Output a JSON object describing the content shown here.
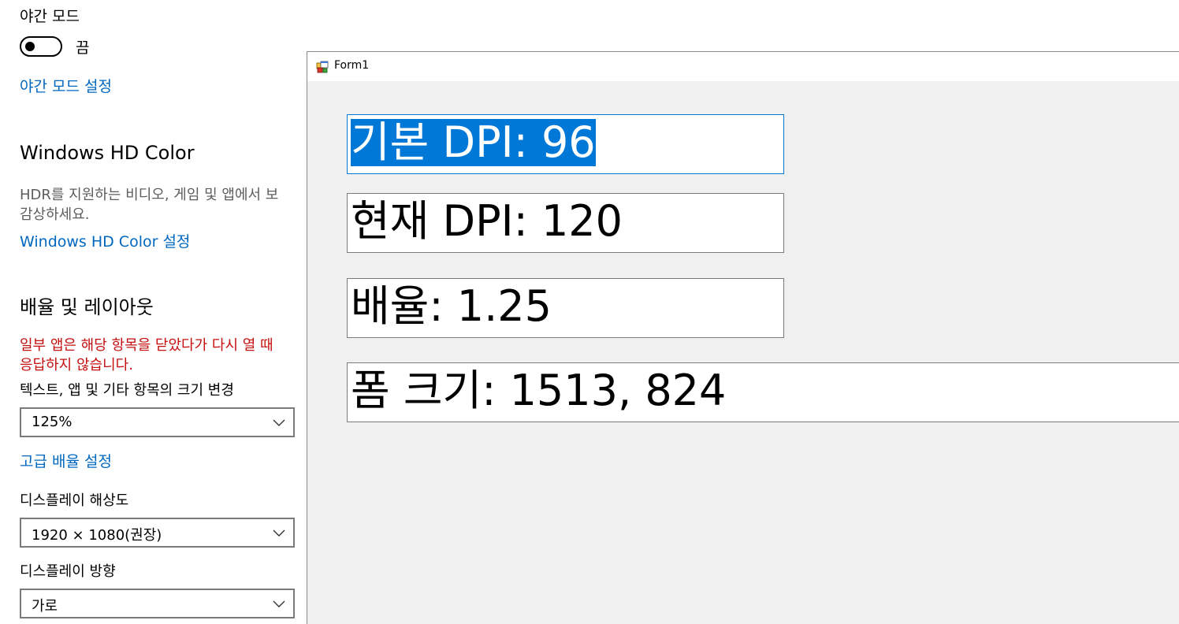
{
  "settings": {
    "night_mode": {
      "title": "야간 모드",
      "toggle_state": "끔",
      "link": "야간 모드 설정"
    },
    "hd_color": {
      "heading": "Windows HD Color",
      "desc_line1": "HDR를 지원하는 비디오, 게임 및 앱에서 보",
      "desc_line2": "감상하세요.",
      "link": "Windows HD Color 설정"
    },
    "scale_layout": {
      "heading": "배율 및 레이아웃",
      "warning_line1": "일부 앱은 해당 항목을 닫았다가 다시 열 때",
      "warning_line2": "응답하지 않습니다.",
      "scale_label": "텍스트, 앱 및 기타 항목의 크기 변경",
      "scale_value": "125%",
      "advanced_link": "고급 배율 설정",
      "resolution_label": "디스플레이 해상도",
      "resolution_value": "1920 × 1080(권장)",
      "orientation_label": "디스플레이 방향",
      "orientation_value": "가로"
    }
  },
  "form": {
    "title": "Form1",
    "textboxes": [
      "기본 DPI: 96",
      "현재 DPI: 120",
      "배율: 1.25",
      "폼 크기: 1513, 824"
    ]
  },
  "colors": {
    "link": "#0067c0",
    "warning": "#c50f0f",
    "selection": "#0078d7",
    "form_bg": "#f0f0f0"
  }
}
